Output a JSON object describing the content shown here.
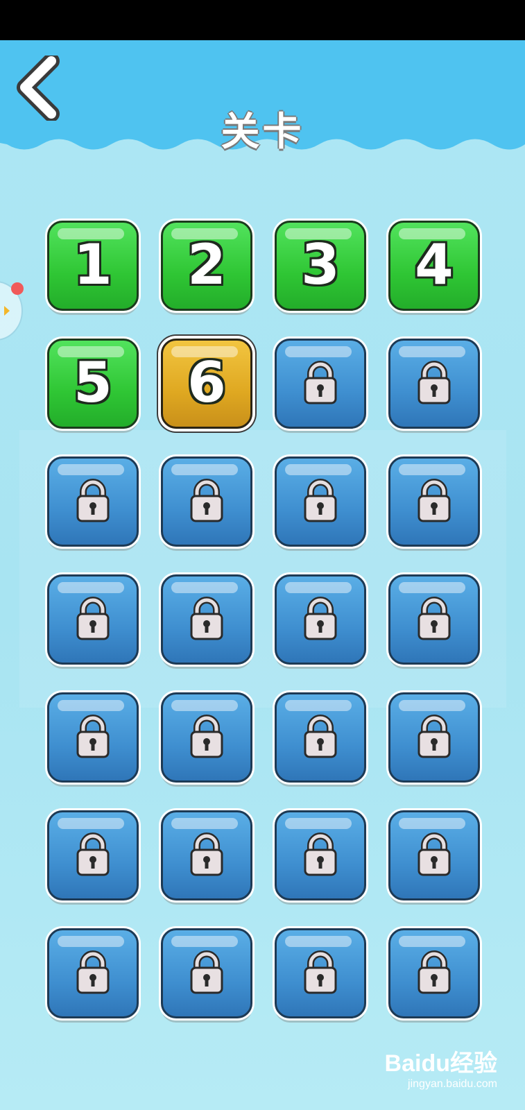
{
  "header": {
    "title": "关卡"
  },
  "levels": [
    {
      "label": "1",
      "state": "done"
    },
    {
      "label": "2",
      "state": "done"
    },
    {
      "label": "3",
      "state": "done"
    },
    {
      "label": "4",
      "state": "done"
    },
    {
      "label": "5",
      "state": "done"
    },
    {
      "label": "6",
      "state": "current"
    },
    {
      "label": "",
      "state": "locked"
    },
    {
      "label": "",
      "state": "locked"
    },
    {
      "label": "",
      "state": "locked"
    },
    {
      "label": "",
      "state": "locked"
    },
    {
      "label": "",
      "state": "locked"
    },
    {
      "label": "",
      "state": "locked"
    },
    {
      "label": "",
      "state": "locked"
    },
    {
      "label": "",
      "state": "locked"
    },
    {
      "label": "",
      "state": "locked"
    },
    {
      "label": "",
      "state": "locked"
    },
    {
      "label": "",
      "state": "locked"
    },
    {
      "label": "",
      "state": "locked"
    },
    {
      "label": "",
      "state": "locked"
    },
    {
      "label": "",
      "state": "locked"
    },
    {
      "label": "",
      "state": "locked"
    },
    {
      "label": "",
      "state": "locked"
    },
    {
      "label": "",
      "state": "locked"
    },
    {
      "label": "",
      "state": "locked"
    },
    {
      "label": "",
      "state": "locked"
    },
    {
      "label": "",
      "state": "locked"
    },
    {
      "label": "",
      "state": "locked"
    },
    {
      "label": "",
      "state": "locked"
    }
  ],
  "watermark": {
    "main": "Baidu经验",
    "sub": "jingyan.baidu.com"
  },
  "colors": {
    "sky": "#4fc3f0",
    "done": "#35c83b",
    "current": "#e0aa25",
    "locked": "#3f8fd0"
  },
  "icons": {
    "back": "chevron-left-icon",
    "lock": "padlock-icon"
  }
}
